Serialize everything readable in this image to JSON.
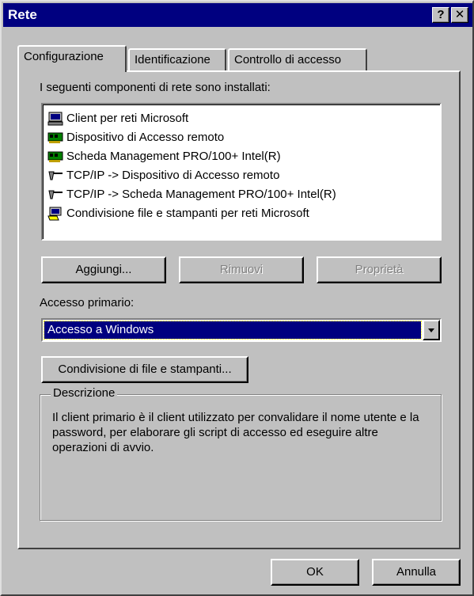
{
  "window": {
    "title": "Rete"
  },
  "titlebar": {
    "help_label": "?",
    "close_label": "✕"
  },
  "tabs": [
    {
      "label": "Configurazione"
    },
    {
      "label": "Identificazione"
    },
    {
      "label": "Controllo di accesso"
    }
  ],
  "config": {
    "installed_label": "I seguenti componenti di rete sono installati:",
    "components": [
      {
        "label": "Client per reti Microsoft",
        "icon": "client-icon"
      },
      {
        "label": "Dispositivo di Accesso remoto",
        "icon": "network-adapter-icon"
      },
      {
        "label": "Scheda Management PRO/100+ Intel(R)",
        "icon": "network-adapter-icon"
      },
      {
        "label": "TCP/IP -> Dispositivo di Accesso remoto",
        "icon": "protocol-icon"
      },
      {
        "label": "TCP/IP -> Scheda Management PRO/100+ Intel(R)",
        "icon": "protocol-icon"
      },
      {
        "label": "Condivisione file e stampanti per reti Microsoft",
        "icon": "service-icon"
      }
    ],
    "add_label": "Aggiungi...",
    "remove_label": "Rimuovi",
    "properties_label": "Proprietà",
    "primary_logon_label": "Accesso primario:",
    "primary_logon_value": "Accesso a Windows",
    "sharing_button_label": "Condivisione di file e stampanti...",
    "description_title": "Descrizione",
    "description_text": "Il client primario è il client utilizzato per convalidare il nome utente e la password, per elaborare gli script di accesso ed eseguire altre operazioni di avvio."
  },
  "footer": {
    "ok_label": "OK",
    "cancel_label": "Annulla"
  }
}
